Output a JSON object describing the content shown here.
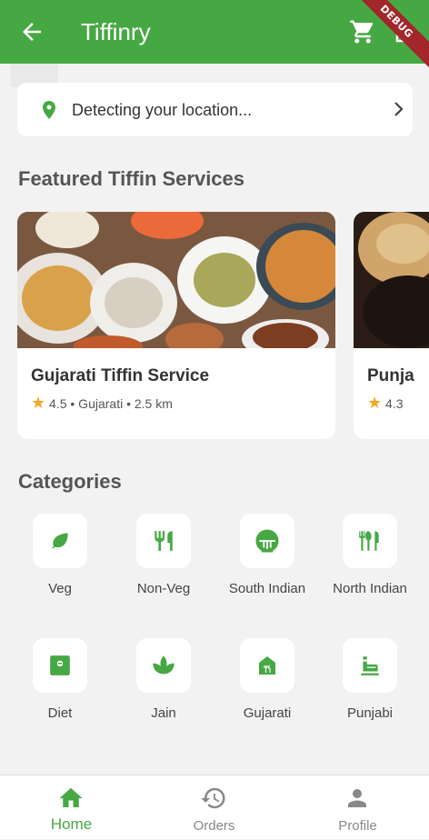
{
  "app": {
    "title": "Tiffinry",
    "debug_banner": "DEBUG"
  },
  "location": {
    "text": "Detecting your location..."
  },
  "featured": {
    "heading": "Featured Tiffin Services",
    "cards": [
      {
        "name": "Gujarati Tiffin Service",
        "rating": "4.5",
        "cuisine": "Gujarati",
        "distance": "2.5 km",
        "meta": "4.5 • Gujarati • 2.5 km"
      },
      {
        "name": "Punja",
        "rating": "4.3",
        "meta": "4.3"
      }
    ]
  },
  "categories": {
    "heading": "Categories",
    "items": [
      {
        "label": "Veg",
        "icon": "leaf-icon"
      },
      {
        "label": "Non-Veg",
        "icon": "restaurant-icon"
      },
      {
        "label": "South Indian",
        "icon": "rice-bowl-icon"
      },
      {
        "label": "North Indian",
        "icon": "dining-icon"
      },
      {
        "label": "Diet",
        "icon": "diet-icon"
      },
      {
        "label": "Jain",
        "icon": "spa-icon"
      },
      {
        "label": "Gujarati",
        "icon": "house-food-icon"
      },
      {
        "label": "Punjabi",
        "icon": "tandoor-icon"
      }
    ]
  },
  "bottom_nav": {
    "items": [
      {
        "label": "Home",
        "active": true
      },
      {
        "label": "Orders",
        "active": false
      },
      {
        "label": "Profile",
        "active": false
      }
    ]
  },
  "colors": {
    "primary": "#46a843",
    "star": "#f5a623",
    "inactive": "#888888"
  }
}
